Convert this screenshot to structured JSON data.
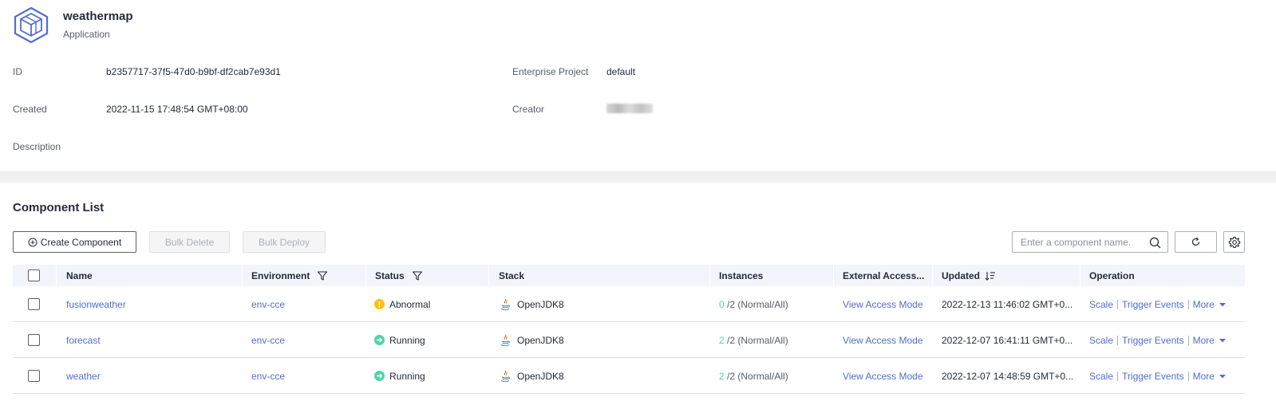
{
  "app": {
    "name": "weathermap",
    "type": "Application",
    "icon": "cube-box-icon"
  },
  "info": {
    "id_label": "ID",
    "id_value": "b2357717-37f5-47d0-b9bf-df2cab7e93d1",
    "enterprise_label": "Enterprise Project",
    "enterprise_value": "default",
    "created_label": "Created",
    "created_value": "2022-11-15 17:48:54 GMT+08:00",
    "creator_label": "Creator",
    "description_label": "Description"
  },
  "component_list": {
    "title": "Component List",
    "create_button": "Create Component",
    "bulk_delete_button": "Bulk Delete",
    "bulk_deploy_button": "Bulk Deploy",
    "search_placeholder": "Enter a component name.",
    "columns": {
      "name": "Name",
      "environment": "Environment",
      "status": "Status",
      "stack": "Stack",
      "instances": "Instances",
      "external_access": "External Access...",
      "updated": "Updated",
      "operation": "Operation"
    },
    "rows": [
      {
        "name": "fusionweather",
        "environment": "env-cce",
        "status": "Abnormal",
        "stack": "OpenJDK8",
        "instances_normal": "0",
        "instances_rest": " /2 (Normal/All)",
        "external_access": "View Access Mode",
        "updated": "2022-12-13 11:46:02 GMT+0...",
        "op_scale": "Scale",
        "op_trigger": "Trigger Events",
        "op_more": "More"
      },
      {
        "name": "forecast",
        "environment": "env-cce",
        "status": "Running",
        "stack": "OpenJDK8",
        "instances_normal": "2",
        "instances_rest": " /2 (Normal/All)",
        "external_access": "View Access Mode",
        "updated": "2022-12-07 16:41:11 GMT+0...",
        "op_scale": "Scale",
        "op_trigger": "Trigger Events",
        "op_more": "More"
      },
      {
        "name": "weather",
        "environment": "env-cce",
        "status": "Running",
        "stack": "OpenJDK8",
        "instances_normal": "2",
        "instances_rest": " /2 (Normal/All)",
        "external_access": "View Access Mode",
        "updated": "2022-12-07 14:48:59 GMT+0...",
        "op_scale": "Scale",
        "op_trigger": "Trigger Events",
        "op_more": "More"
      }
    ]
  },
  "colors": {
    "link": "#526ecc",
    "abnormal": "#fac20a",
    "running": "#50d4ab",
    "header_bg": "#f2f5fc"
  }
}
